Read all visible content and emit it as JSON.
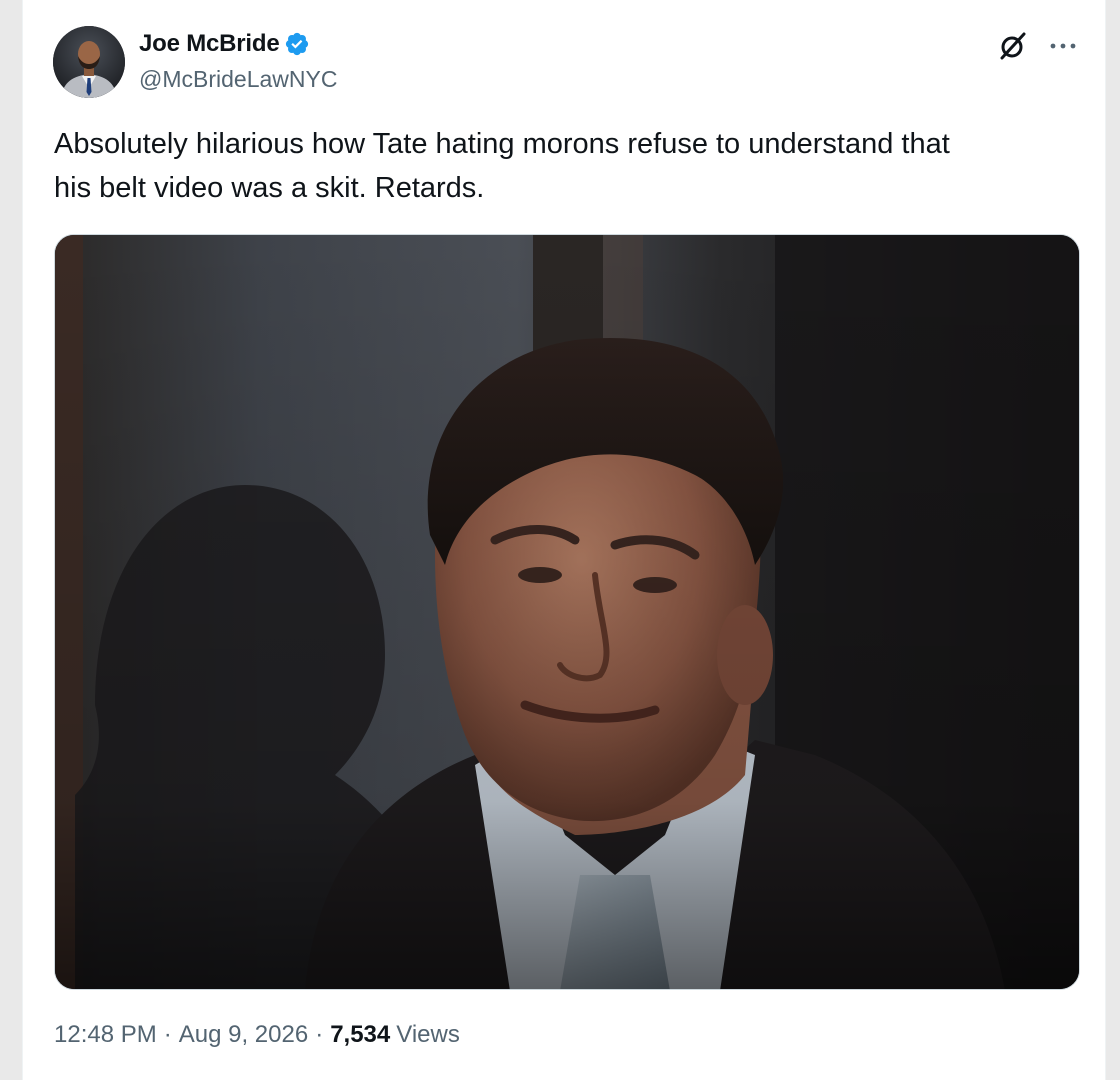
{
  "author": {
    "display_name": "Joe McBride",
    "handle": "@McBrideLawNYC",
    "verified": true,
    "avatar_icon": "profile-photo",
    "verified_color": "#1d9bf0"
  },
  "actions": {
    "grok_icon": "grok-icon",
    "more_icon": "more-options-icon",
    "more_label": "···"
  },
  "tweet": {
    "text": "Absolutely hilarious how Tate hating morons refuse to understand that\nhis belt video was a skit. Retards."
  },
  "media": {
    "type": "video"
  },
  "meta": {
    "time": "12:48 PM",
    "separator": "·",
    "date": "Aug 9, 2026",
    "views_count": "7,534",
    "views_label": "Views"
  }
}
